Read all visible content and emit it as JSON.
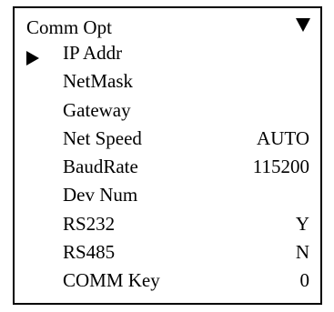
{
  "screen": {
    "title": "Comm Opt",
    "scroll_indicator": "down-triangle-icon"
  },
  "menu": {
    "selected_index": 0,
    "cursor_icon": "right-triangle-icon",
    "items": [
      {
        "label": "IP Addr",
        "value": ""
      },
      {
        "label": "NetMask",
        "value": ""
      },
      {
        "label": "Gateway",
        "value": ""
      },
      {
        "label": "Net Speed",
        "value": "AUTO"
      },
      {
        "label": "BaudRate",
        "value": "115200"
      },
      {
        "label": "Dev Num",
        "value": ""
      },
      {
        "label": "RS232",
        "value": "Y"
      },
      {
        "label": "RS485",
        "value": "N"
      },
      {
        "label": "COMM Key",
        "value": "0"
      }
    ]
  }
}
